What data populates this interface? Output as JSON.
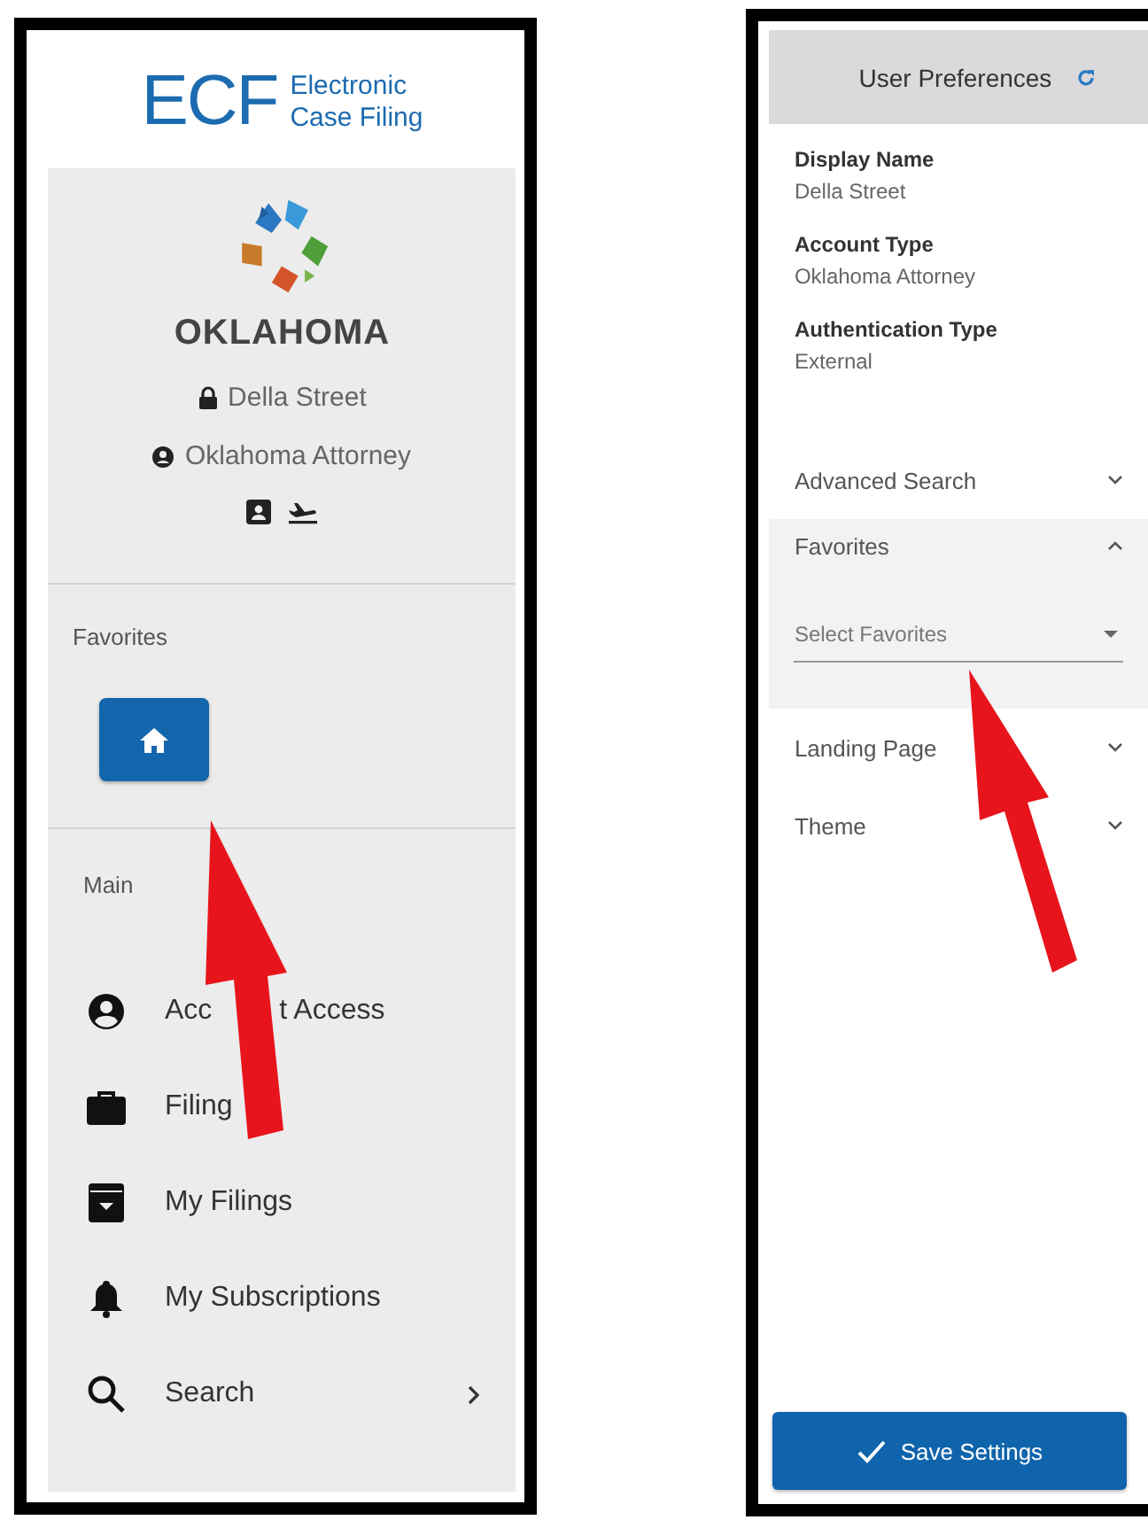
{
  "left_panel": {
    "logo": {
      "mark": "ECF",
      "line1": "Electronic",
      "line2": "Case Filing"
    },
    "state_name": "OKLAHOMA",
    "user": {
      "name": "Della Street",
      "role": "Oklahoma Attorney"
    },
    "favorites": {
      "title": "Favorites"
    },
    "main": {
      "title": "Main",
      "items": [
        {
          "label_parts": [
            "Acc",
            "t Access"
          ],
          "kind": "account",
          "has_submenu": false
        },
        {
          "label_parts": [
            "Filing"
          ],
          "kind": "briefcase",
          "has_submenu": false
        },
        {
          "label_parts": [
            "My Filings"
          ],
          "kind": "archive",
          "has_submenu": false
        },
        {
          "label_parts": [
            "My Subscriptions"
          ],
          "kind": "bell",
          "has_submenu": false
        },
        {
          "label_parts": [
            "Search"
          ],
          "kind": "search",
          "has_submenu": true
        }
      ]
    }
  },
  "right_panel": {
    "title": "User Preferences",
    "fields": [
      {
        "label": "Display Name",
        "value": "Della Street"
      },
      {
        "label": "Account Type",
        "value": "Oklahoma Attorney"
      },
      {
        "label": "Authentication Type",
        "value": "External"
      }
    ],
    "sections": [
      {
        "label": "Advanced Search",
        "expanded": false
      },
      {
        "label": "Favorites",
        "expanded": true,
        "placeholder": "Select Favorites"
      },
      {
        "label": "Landing Page",
        "expanded": false
      },
      {
        "label": "Theme",
        "expanded": false
      }
    ],
    "save_button": "Save Settings"
  }
}
